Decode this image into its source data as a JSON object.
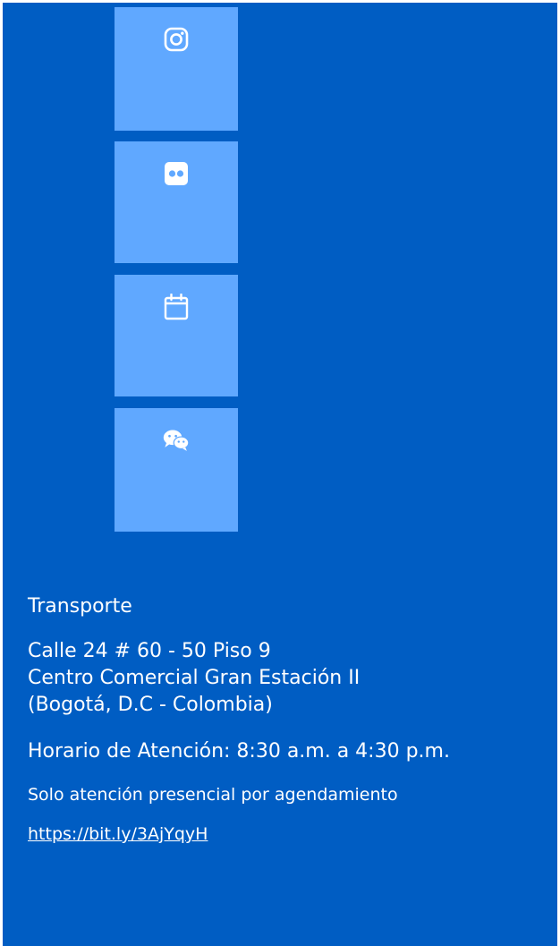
{
  "social": [
    {
      "icon": "instagram-icon"
    },
    {
      "icon": "flickr-icon"
    },
    {
      "icon": "calendar-icon"
    },
    {
      "icon": "wechat-icon"
    }
  ],
  "colors": {
    "panel": "#005dc3",
    "tile": "#60a8ff",
    "text": "#ffffff"
  },
  "info": {
    "section_label": "Transporte",
    "address_line1": "Calle 24 # 60 - 50 Piso 9",
    "address_line2": "Centro Comercial Gran Estación II",
    "address_line3": "(Bogotá, D.C - Colombia)",
    "hours": "Horario de Atención: 8:30 a.m. a 4:30 p.m.",
    "note": "Solo atención presencial por agendamiento",
    "link": "https://bit.ly/3AjYqyH"
  }
}
